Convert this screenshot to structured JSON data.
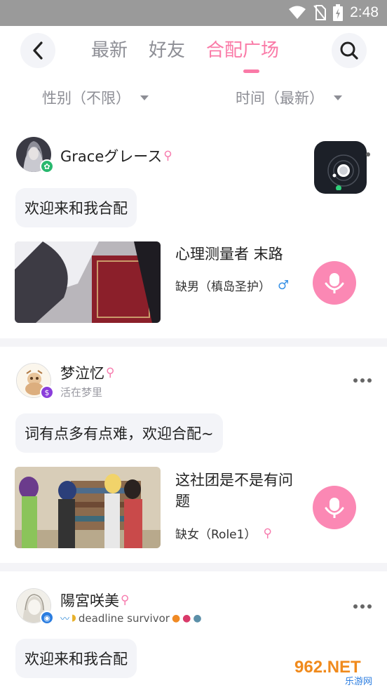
{
  "status_bar": {
    "time": "2:48"
  },
  "header": {
    "tabs": [
      {
        "label": "最新",
        "active": false
      },
      {
        "label": "好友",
        "active": false
      },
      {
        "label": "合配广场",
        "active": true
      }
    ]
  },
  "filters": {
    "gender": "性别（不限）",
    "time": "时间（最新）"
  },
  "posts": [
    {
      "username": "Graceグレース",
      "user_gender": "female",
      "signature": "",
      "message": "欢迎来和我合配",
      "drama_title": "心理测量者  末路",
      "need": "缺男（槙岛圣护）",
      "need_gender": "male"
    },
    {
      "username": "梦泣忆",
      "user_gender": "female",
      "signature": "活在梦里",
      "message": "词有点多有点难，欢迎合配~",
      "drama_title": "这社团是不是有问题",
      "need": "缺女（Role1）",
      "need_gender": "female"
    },
    {
      "username": "陽宮咲美",
      "user_gender": "female",
      "signature": "deadline survivor",
      "message": "欢迎来和我合配"
    }
  ],
  "watermark": {
    "main": "962.NET",
    "sub": "乐游网"
  },
  "colors": {
    "accent": "#fa7aa7",
    "mic": "#fb88b4",
    "bubble": "#f3f4f8",
    "muted": "#8d8e95"
  }
}
